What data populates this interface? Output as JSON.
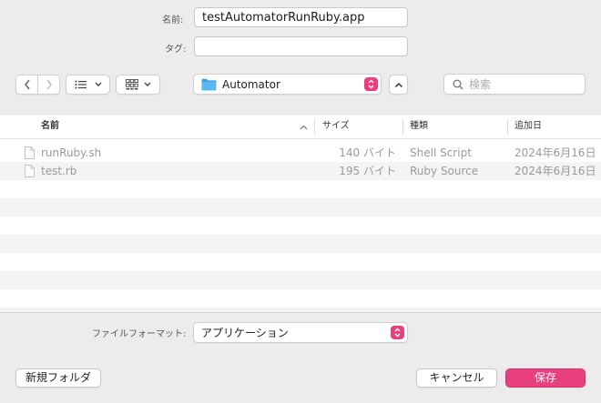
{
  "form": {
    "name_label": "名前:",
    "name_value": "testAutomatorRunRuby.app",
    "tag_label": "タグ:",
    "tag_value": ""
  },
  "toolbar": {
    "location": "Automator",
    "search_placeholder": "検索"
  },
  "table": {
    "columns": [
      "名前",
      "サイズ",
      "種類",
      "追加日"
    ],
    "rows": [
      {
        "name": "runRuby.sh",
        "size": "140 バイト",
        "kind": "Shell Script",
        "date": "2024年6月16日"
      },
      {
        "name": "test.rb",
        "size": "195 バイト",
        "kind": "Ruby Source",
        "date": "2024年6月16日"
      }
    ]
  },
  "format": {
    "label": "ファイルフォーマット:",
    "value": "アプリケーション"
  },
  "buttons": {
    "new_folder": "新規フォルダ",
    "cancel": "キャンセル",
    "save": "保存"
  },
  "colors": {
    "accent": "#e8407e",
    "folder": "#3aa0e8"
  },
  "icons": [
    "chevron-left-icon",
    "chevron-right-icon",
    "list-view-icon",
    "grid-view-icon",
    "folder-icon",
    "up-arrow-icon",
    "search-icon",
    "file-icon",
    "sort-ascending-icon"
  ]
}
